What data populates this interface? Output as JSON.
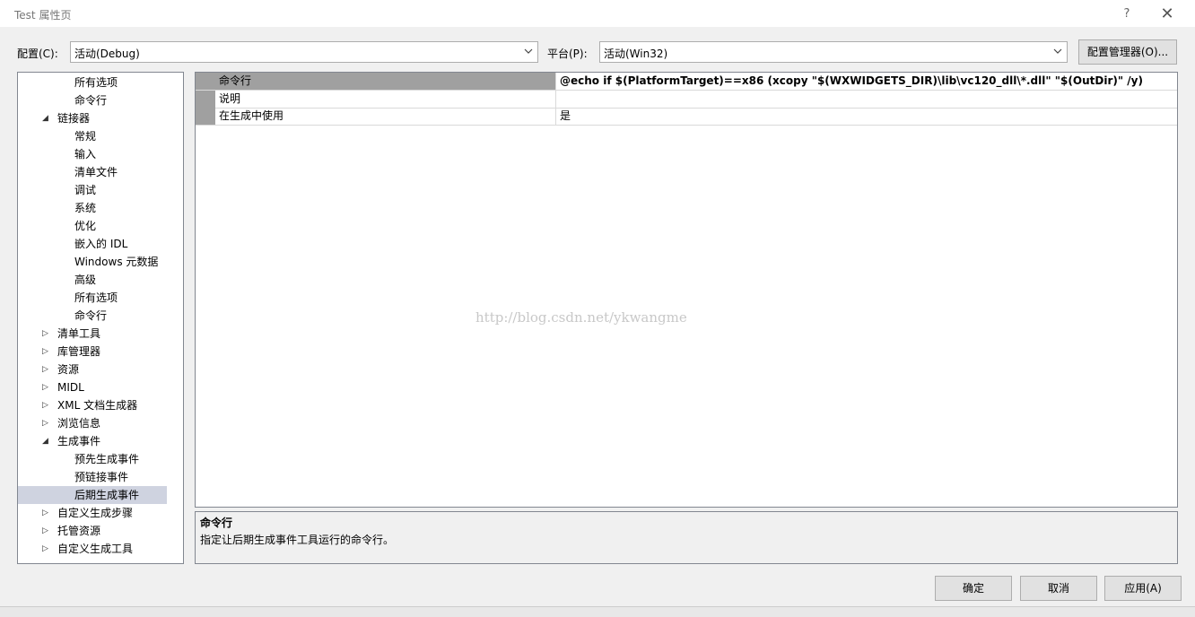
{
  "window": {
    "title": "Test 属性页",
    "help_glyph": "?",
    "close_glyph": "✕"
  },
  "config": {
    "config_label": "配置(C):",
    "config_value": "活动(Debug)",
    "platform_label": "平台(P):",
    "platform_value": "活动(Win32)",
    "manager_button": "配置管理器(O)..."
  },
  "tree": {
    "items": [
      {
        "label": "所有选项",
        "indent": 2,
        "expander": "none"
      },
      {
        "label": "命令行",
        "indent": 2,
        "expander": "none"
      },
      {
        "label": "链接器",
        "indent": 1,
        "expander": "expanded"
      },
      {
        "label": "常规",
        "indent": 2,
        "expander": "none"
      },
      {
        "label": "输入",
        "indent": 2,
        "expander": "none"
      },
      {
        "label": "清单文件",
        "indent": 2,
        "expander": "none"
      },
      {
        "label": "调试",
        "indent": 2,
        "expander": "none"
      },
      {
        "label": "系统",
        "indent": 2,
        "expander": "none"
      },
      {
        "label": "优化",
        "indent": 2,
        "expander": "none"
      },
      {
        "label": "嵌入的 IDL",
        "indent": 2,
        "expander": "none"
      },
      {
        "label": "Windows 元数据",
        "indent": 2,
        "expander": "none"
      },
      {
        "label": "高级",
        "indent": 2,
        "expander": "none"
      },
      {
        "label": "所有选项",
        "indent": 2,
        "expander": "none"
      },
      {
        "label": "命令行",
        "indent": 2,
        "expander": "none"
      },
      {
        "label": "清单工具",
        "indent": 1,
        "expander": "collapsed"
      },
      {
        "label": "库管理器",
        "indent": 1,
        "expander": "collapsed"
      },
      {
        "label": "资源",
        "indent": 1,
        "expander": "collapsed"
      },
      {
        "label": "MIDL",
        "indent": 1,
        "expander": "collapsed"
      },
      {
        "label": "XML 文档生成器",
        "indent": 1,
        "expander": "collapsed"
      },
      {
        "label": "浏览信息",
        "indent": 1,
        "expander": "collapsed"
      },
      {
        "label": "生成事件",
        "indent": 1,
        "expander": "expanded"
      },
      {
        "label": "预先生成事件",
        "indent": 2,
        "expander": "none"
      },
      {
        "label": "预链接事件",
        "indent": 2,
        "expander": "none"
      },
      {
        "label": "后期生成事件",
        "indent": 2,
        "expander": "none",
        "selected": true
      },
      {
        "label": "自定义生成步骤",
        "indent": 1,
        "expander": "collapsed"
      },
      {
        "label": "托管资源",
        "indent": 1,
        "expander": "collapsed"
      },
      {
        "label": "自定义生成工具",
        "indent": 1,
        "expander": "collapsed"
      }
    ]
  },
  "grid": {
    "rows": [
      {
        "name": "命令行",
        "value": "@echo  if $(PlatformTarget)==x86 (xcopy \"$(WXWIDGETS_DIR)\\lib\\vc120_dll\\*.dll\"  \"$(OutDir)\" /y)"
      },
      {
        "name": "说明",
        "value": ""
      },
      {
        "name": "在生成中使用",
        "value": "是"
      }
    ],
    "watermark": "http://blog.csdn.net/ykwangme"
  },
  "description": {
    "title": "命令行",
    "text": "指定让后期生成事件工具运行的命令行。"
  },
  "buttons": {
    "ok": "确定",
    "cancel": "取消",
    "apply": "应用(A)"
  },
  "colors": {
    "header_gray": "#a0a0a0",
    "selection": "#cfd3e0"
  }
}
